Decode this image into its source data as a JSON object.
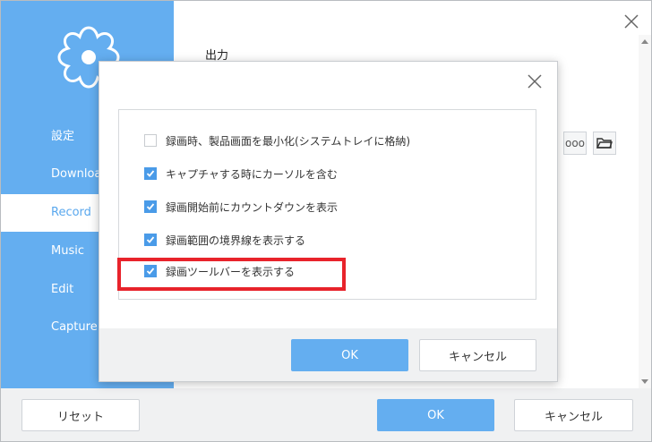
{
  "sidebar": {
    "items": [
      {
        "label": "設定"
      },
      {
        "label": "Download"
      },
      {
        "label": "Record"
      },
      {
        "label": "Music"
      },
      {
        "label": "Edit"
      },
      {
        "label": "Capture"
      }
    ],
    "active": "Record"
  },
  "main": {
    "section_title": "出力",
    "more_button_label": "ooo"
  },
  "footer": {
    "reset_label": "リセット",
    "ok_label": "OK",
    "cancel_label": "キャンセル"
  },
  "dialog": {
    "options": [
      {
        "label": "録画時、製品画面を最小化(システムトレイに格納)",
        "checked": false
      },
      {
        "label": "キャプチャする時にカーソルを含む",
        "checked": true
      },
      {
        "label": "録画開始前にカウントダウンを表示",
        "checked": true
      },
      {
        "label": "録画範囲の境界線を表示する",
        "checked": true
      },
      {
        "label": "録画ツールバーを表示する",
        "checked": true,
        "highlighted": true
      }
    ],
    "ok_label": "OK",
    "cancel_label": "キャンセル"
  },
  "colors": {
    "accent": "#64aef0",
    "highlight": "#e8232b"
  }
}
